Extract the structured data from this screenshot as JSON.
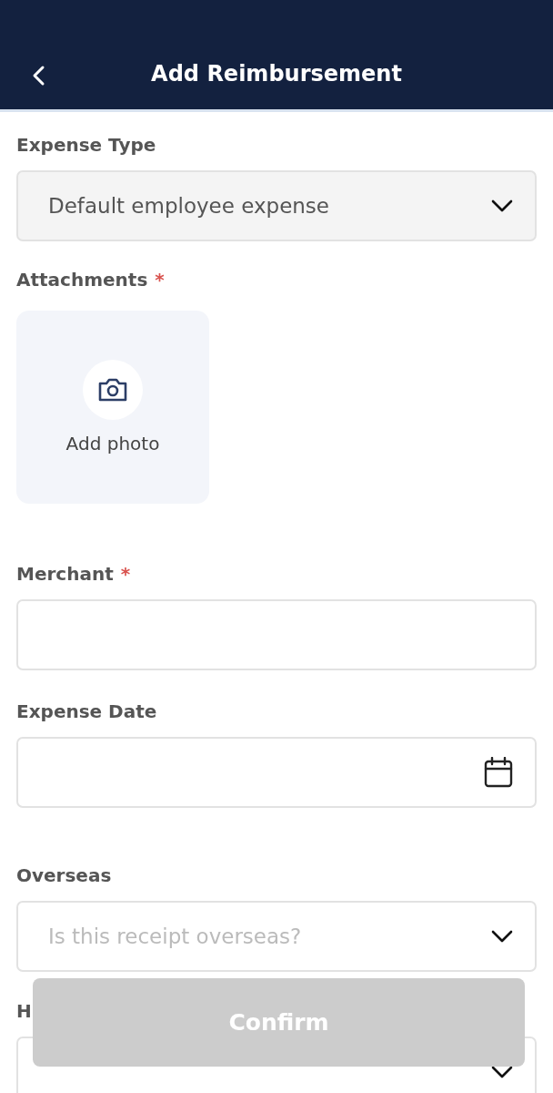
{
  "header": {
    "title": "Add Reimbursement"
  },
  "fields": [
    {
      "kind": "select",
      "label": "Expense Type",
      "required": false,
      "value": "Default employee expense"
    },
    {
      "kind": "photo",
      "label": "Attachments",
      "required": true,
      "required_mark": "*",
      "action": "Add photo"
    },
    {
      "kind": "text",
      "label": "Merchant",
      "required": true,
      "required_mark": "*"
    },
    {
      "kind": "date",
      "label": "Expense Date",
      "required": false
    },
    {
      "kind": "select",
      "label": "Overseas",
      "required": false,
      "placeholder": "Is this receipt overseas?"
    },
    {
      "kind": "select",
      "label": "H",
      "required": false
    }
  ],
  "confirm_button": {
    "label": "Confirm",
    "disabled": true
  }
}
